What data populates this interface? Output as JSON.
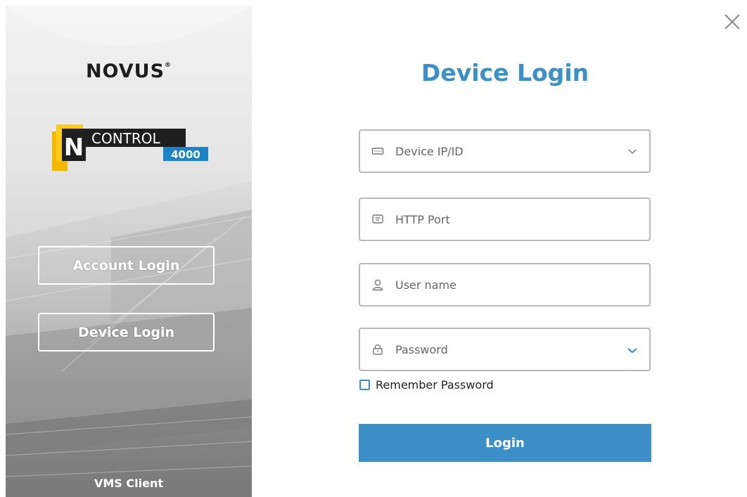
{
  "brand": {
    "name": "NOVUS",
    "registered_mark": "®"
  },
  "product": {
    "line1": "N",
    "line2": "CONTROL",
    "line3": "4000"
  },
  "sidebar": {
    "account_login_label": "Account Login",
    "device_login_label": "Device Login",
    "footer_label": "VMS Client"
  },
  "form": {
    "title": "Device Login",
    "device_ip": {
      "placeholder": "Device IP/ID",
      "value": ""
    },
    "http_port": {
      "placeholder": "HTTP Port",
      "value": ""
    },
    "username": {
      "placeholder": "User name",
      "value": ""
    },
    "password": {
      "placeholder": "Password",
      "value": ""
    },
    "remember_label": "Remember Password",
    "remember_checked": false,
    "login_label": "Login"
  },
  "colors": {
    "accent": "#3d8fc8",
    "field_border": "#b8b8b8",
    "logo_yellow": "#f5b800",
    "logo_badge_blue": "#1a84c7"
  },
  "icons": {
    "close": "close-icon",
    "device": "device-icon",
    "port": "port-icon",
    "user": "user-icon",
    "lock": "lock-icon",
    "dropdown": "chevron-down-icon"
  }
}
